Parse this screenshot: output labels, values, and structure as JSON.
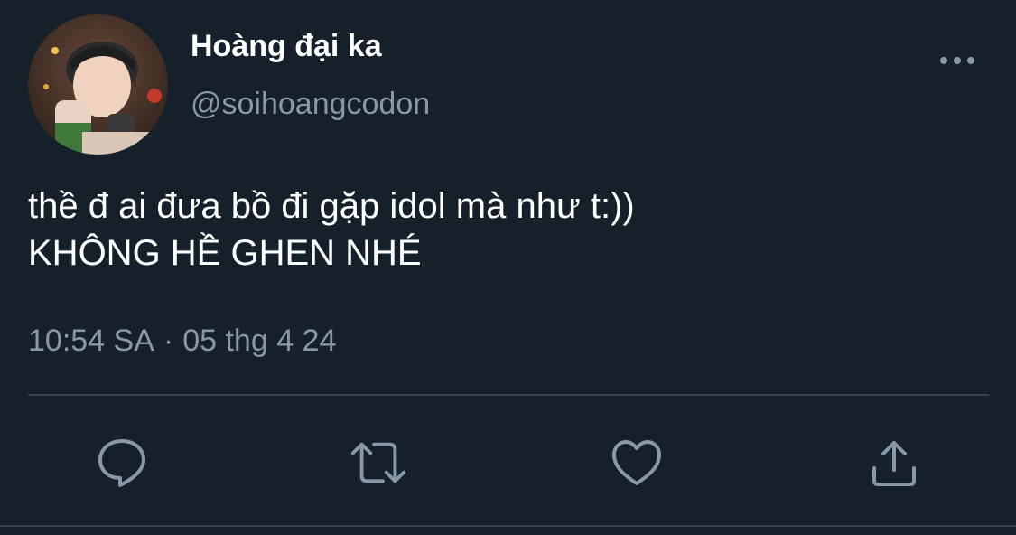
{
  "tweet": {
    "author_name": "Hoàng đại ka",
    "author_handle": "@soihoangcodon",
    "text_lines": [
      "thề đ ai đưa bồ đi gặp idol mà như t:))",
      "KHÔNG HỀ GHEN NHÉ"
    ],
    "time": "10:54 SA",
    "separator": "·",
    "date": "05 thg 4 24"
  },
  "icons": {
    "more": "more-horizontal-icon",
    "reply": "reply-icon",
    "retweet": "retweet-icon",
    "like": "heart-icon",
    "share": "share-icon"
  },
  "colors": {
    "background": "#15202b",
    "primary_text": "#ffffff",
    "secondary_text": "#8899a6",
    "divider": "#38444d"
  }
}
